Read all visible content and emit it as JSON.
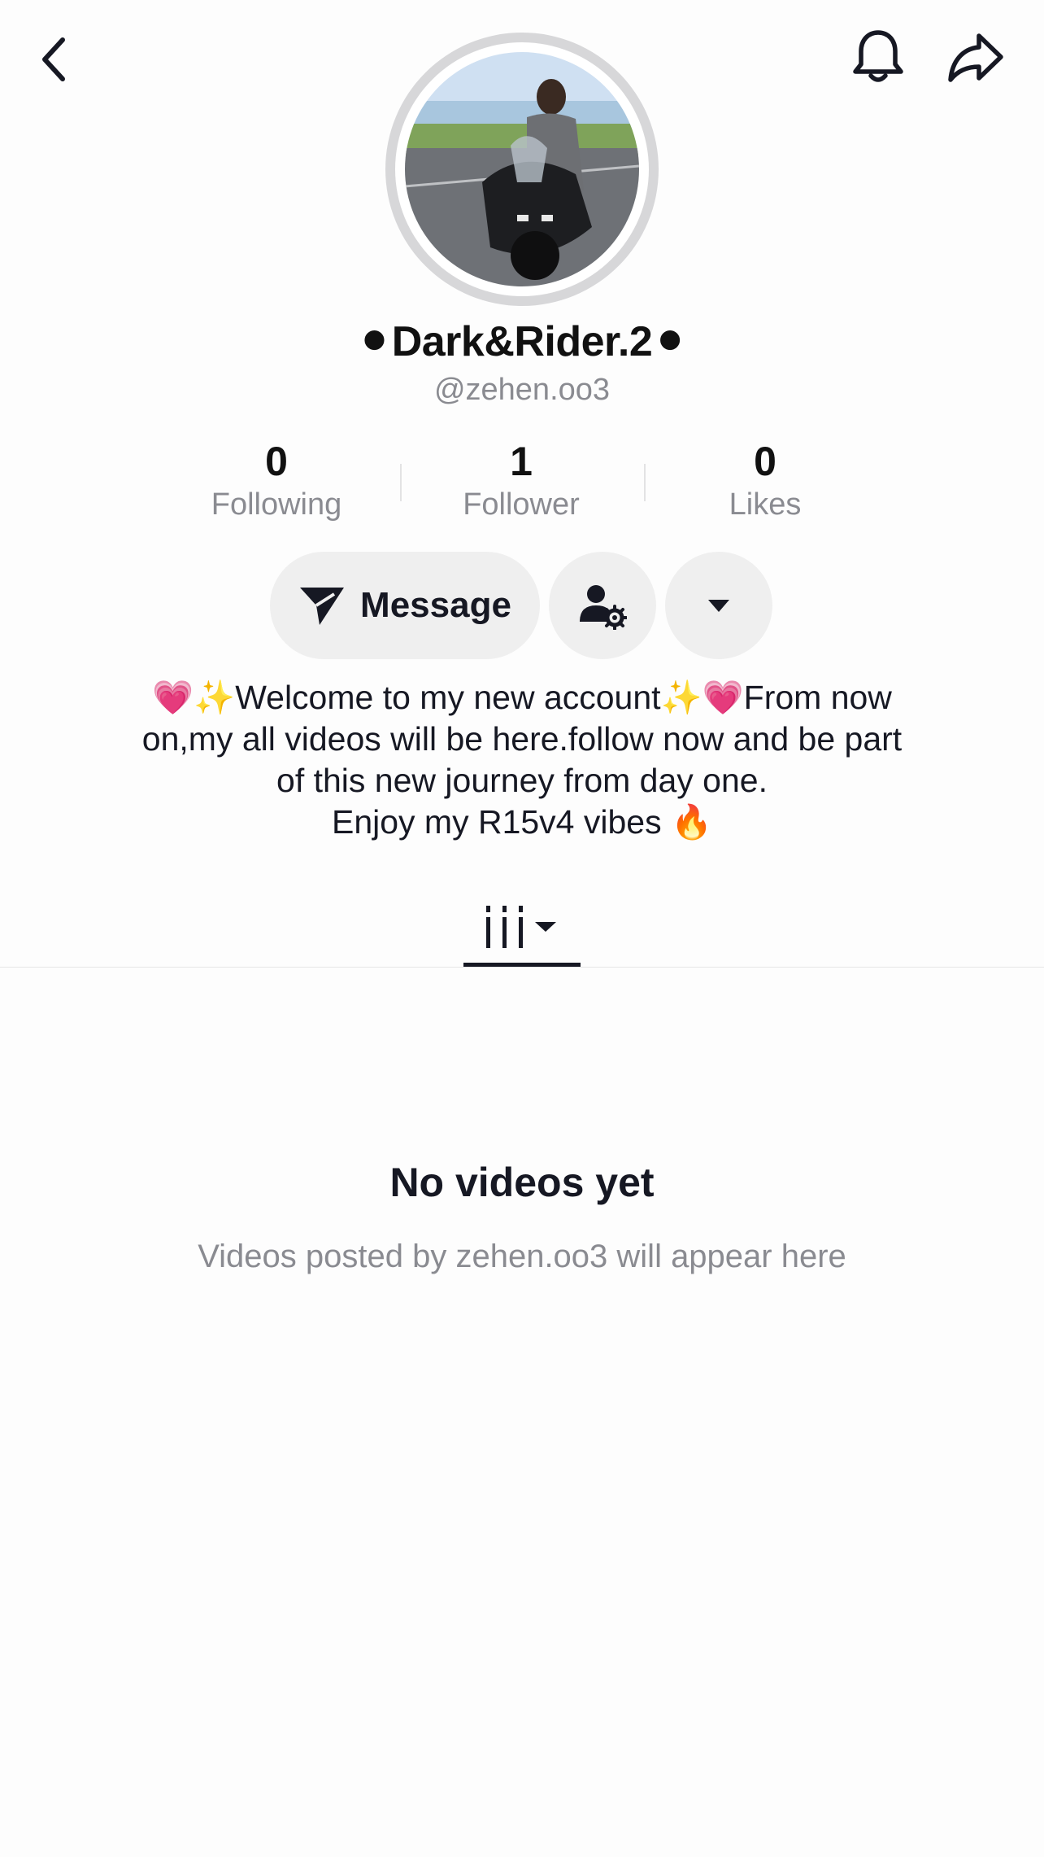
{
  "profile": {
    "display_name": "⚫Dark&Rider.2⚫",
    "username": "@zehen.oo3"
  },
  "stats": [
    {
      "value": "0",
      "label": "Following"
    },
    {
      "value": "1",
      "label": "Follower"
    },
    {
      "value": "0",
      "label": "Likes"
    }
  ],
  "actions": {
    "message_label": "Message"
  },
  "bio": {
    "lines": [
      "💗✨Welcome to my new account✨💗From now",
      "on,my all videos will be here.follow now and be part",
      "of this new journey from day one.",
      "Enjoy my R15v4 vibes 🔥"
    ]
  },
  "empty_state": {
    "title": "No videos yet",
    "subtitle": "Videos posted by zehen.oo3 will appear here"
  },
  "icons": {
    "back": "chevron-left-icon",
    "bell": "bell-icon",
    "share": "share-arrow-icon",
    "send": "paper-plane-icon",
    "profile_settings": "person-gear-icon",
    "more": "caret-down-icon",
    "videos_tab": "grid-bars-icon"
  },
  "colors": {
    "text_primary": "#161823",
    "text_secondary": "#8a8b91",
    "button_bg": "#efefef",
    "avatar_ring": "#d7d7d9"
  }
}
